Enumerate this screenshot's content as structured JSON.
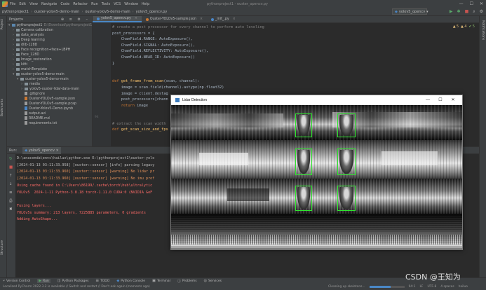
{
  "menubar": {
    "items": [
      "File",
      "Edit",
      "View",
      "Navigate",
      "Code",
      "Refactor",
      "Run",
      "Tools",
      "VCS",
      "Window",
      "Help"
    ],
    "window_title": "pythonproject1 - ouster_opencv.py",
    "controls": [
      "—",
      "☐",
      "✕"
    ]
  },
  "navbar": {
    "crumbs": [
      "pythonproject1",
      "ouster-yolov5-demo-main",
      "ouster-yolov5-demo-main",
      "yolov5_opencv.py"
    ],
    "run_config": "yolov5_opencv"
  },
  "project": {
    "title": "Project",
    "items": [
      {
        "depth": 0,
        "arrow": "▾",
        "kind": "folder",
        "name": "pythonproject1",
        "sub": "D:\\Download\\pythonproject1"
      },
      {
        "depth": 1,
        "arrow": "›",
        "kind": "folder",
        "name": "Camera calibration",
        "sub": ""
      },
      {
        "depth": 1,
        "arrow": "›",
        "kind": "folder",
        "name": "data_analysis",
        "sub": ""
      },
      {
        "depth": 1,
        "arrow": "›",
        "kind": "folder",
        "name": "Deep learning",
        "sub": ""
      },
      {
        "depth": 1,
        "arrow": "›",
        "kind": "folder",
        "name": "dlib-128D",
        "sub": ""
      },
      {
        "depth": 1,
        "arrow": "›",
        "kind": "folder",
        "name": "Face recognition+face+LBPH",
        "sub": ""
      },
      {
        "depth": 1,
        "arrow": "›",
        "kind": "folder",
        "name": "Face_128D",
        "sub": ""
      },
      {
        "depth": 1,
        "arrow": "›",
        "kind": "folder",
        "name": "Image_restoration",
        "sub": ""
      },
      {
        "depth": 1,
        "arrow": "›",
        "kind": "folder",
        "name": "kitti",
        "sub": ""
      },
      {
        "depth": 1,
        "arrow": "›",
        "kind": "folder",
        "name": "matchTemplate",
        "sub": ""
      },
      {
        "depth": 1,
        "arrow": "▾",
        "kind": "folder",
        "name": "ouster-yolov5-demo-main",
        "sub": ""
      },
      {
        "depth": 2,
        "arrow": "▾",
        "kind": "folder",
        "name": "ouster-yolov5-demo-main",
        "sub": ""
      },
      {
        "depth": 3,
        "arrow": "›",
        "kind": "folder",
        "name": "media",
        "sub": ""
      },
      {
        "depth": 3,
        "arrow": "›",
        "kind": "folder",
        "name": "yolov5-ouster-lidar-data-main",
        "sub": ""
      },
      {
        "depth": 3,
        "arrow": "",
        "kind": "txt",
        "name": ".gitignore",
        "sub": ""
      },
      {
        "depth": 3,
        "arrow": "",
        "kind": "json",
        "name": "Ouster-YOLOv5-sample.json",
        "sub": ""
      },
      {
        "depth": 3,
        "arrow": "",
        "kind": "txt",
        "name": "Ouster-YOLOv5-sample.pcap",
        "sub": ""
      },
      {
        "depth": 3,
        "arrow": "",
        "kind": "py",
        "name": "Ouster-Yolov5-Demo.ipynb",
        "sub": ""
      },
      {
        "depth": 3,
        "arrow": "",
        "kind": "txt",
        "name": "output.avi",
        "sub": ""
      },
      {
        "depth": 3,
        "arrow": "",
        "kind": "txt",
        "name": "README.md",
        "sub": ""
      },
      {
        "depth": 3,
        "arrow": "",
        "kind": "txt",
        "name": "requirements.txt",
        "sub": ""
      }
    ]
  },
  "editor": {
    "tabs": [
      {
        "label": "yolov5_opencv.py",
        "active": true
      },
      {
        "label": "Ouster-YOLOv5-sample.json",
        "active": false
      },
      {
        "label": "_init_.py",
        "active": false
      }
    ],
    "inspections": {
      "warnings": "▲ 5",
      "weak": "▲ 4",
      "ok": "✔ 5"
    },
    "lines": [
      {
        "n": "",
        "html": "<span class='cm'># create a post processor for every channel to perform auto leveling</span>"
      },
      {
        "n": "",
        "html": "post_processors = {"
      },
      {
        "n": "",
        "html": "    ChanField.RANGE: AutoExposure(),"
      },
      {
        "n": "",
        "html": "    ChanField.SIGNAL: AutoExposure(),"
      },
      {
        "n": "",
        "html": "    ChanField.REFLECTIVITY: AutoExposure(),"
      },
      {
        "n": "",
        "html": "    ChanField.NEAR_IR: AutoExposure()"
      },
      {
        "n": "",
        "html": "}"
      },
      {
        "n": "",
        "html": ""
      },
      {
        "n": "",
        "html": ""
      },
      {
        "n": "",
        "html": "<span class='kw'>def</span> <span class='fn'>get_frame_from_scan</span>(scan, channel):"
      },
      {
        "n": "",
        "html": "    image = scan.field(channel).astype(np.float32)"
      },
      {
        "n": "",
        "html": "    image = client.destag"
      },
      {
        "n": "",
        "html": "    post_processors[chann"
      },
      {
        "n": "",
        "html": "    <span class='kw'>return</span> image"
      },
      {
        "n": "",
        "html": ""
      },
      {
        "n": "",
        "html": ""
      },
      {
        "n": "",
        "html": "<span class='cm'># extract the scan width</span>"
      },
      {
        "n": "",
        "html": "<span class='kw'>def</span> <span class='fn'>get_scan_size_and_fps</span>"
      }
    ],
    "line_numbers": [
      "",
      "",
      "",
      "",
      "",
      "",
      "",
      "",
      "",
      "",
      "",
      "",
      "",
      "",
      "",
      "94",
      "",
      ""
    ]
  },
  "run": {
    "label": "Run:",
    "tab": "yolov5_opencv",
    "output": [
      {
        "cls": "",
        "text": "D:\\anaconda\\envs\\hailuo\\python.exe E:\\pythonproject1\\ouster-yolo"
      },
      {
        "cls": "",
        "text": "[2024-01-13 03:11:33.958] [ouster::sensor] [info] parsing legacy"
      },
      {
        "cls": "org",
        "text": "[2024-01-13 03:11:33.960] [ouster::sensor] [warning] No lidar pr"
      },
      {
        "cls": "org",
        "text": "[2024-01-13 03:11:33.960] [ouster::sensor] [warning] No imu prof"
      },
      {
        "cls": "red",
        "text": "Using cache found in C:\\Users\\86199/.cache\\torch\\hub\\ultralytic"
      },
      {
        "cls": "red",
        "text": "YOLOv5  2024-1-11 Python-3.8.18 torch-1.11.0 CUDA:0 (NVIDIA GeF"
      },
      {
        "cls": "",
        "text": ""
      },
      {
        "cls": "red",
        "text": "Fusing layers..."
      },
      {
        "cls": "red",
        "text": "YOLOv5s summary: 213 layers, 7225885 parameters, 0 gradients"
      },
      {
        "cls": "red",
        "text": "Adding AutoShape..."
      }
    ]
  },
  "lidar_window": {
    "title": "Lidar Detection",
    "controls": [
      "—",
      "☐",
      "✕"
    ]
  },
  "toolbar": {
    "items": [
      "Version Control",
      "Run",
      "Python Packages",
      "TODO",
      "Python Console",
      "Terminal",
      "Problems",
      "Services"
    ]
  },
  "statusbar": {
    "left": "Localized PyCharm 2022.3.2 is available // Switch and restart // Don't ask again (moments ago)",
    "right": [
      "Cleaning up skeletons...",
      "94:1",
      "LF",
      "UTF-8",
      "4 spaces",
      "hailuo"
    ]
  },
  "watermark": "CSDN @王知为",
  "colors": {
    "accent": "#4a88c7",
    "bbox": "#2ee52e"
  }
}
